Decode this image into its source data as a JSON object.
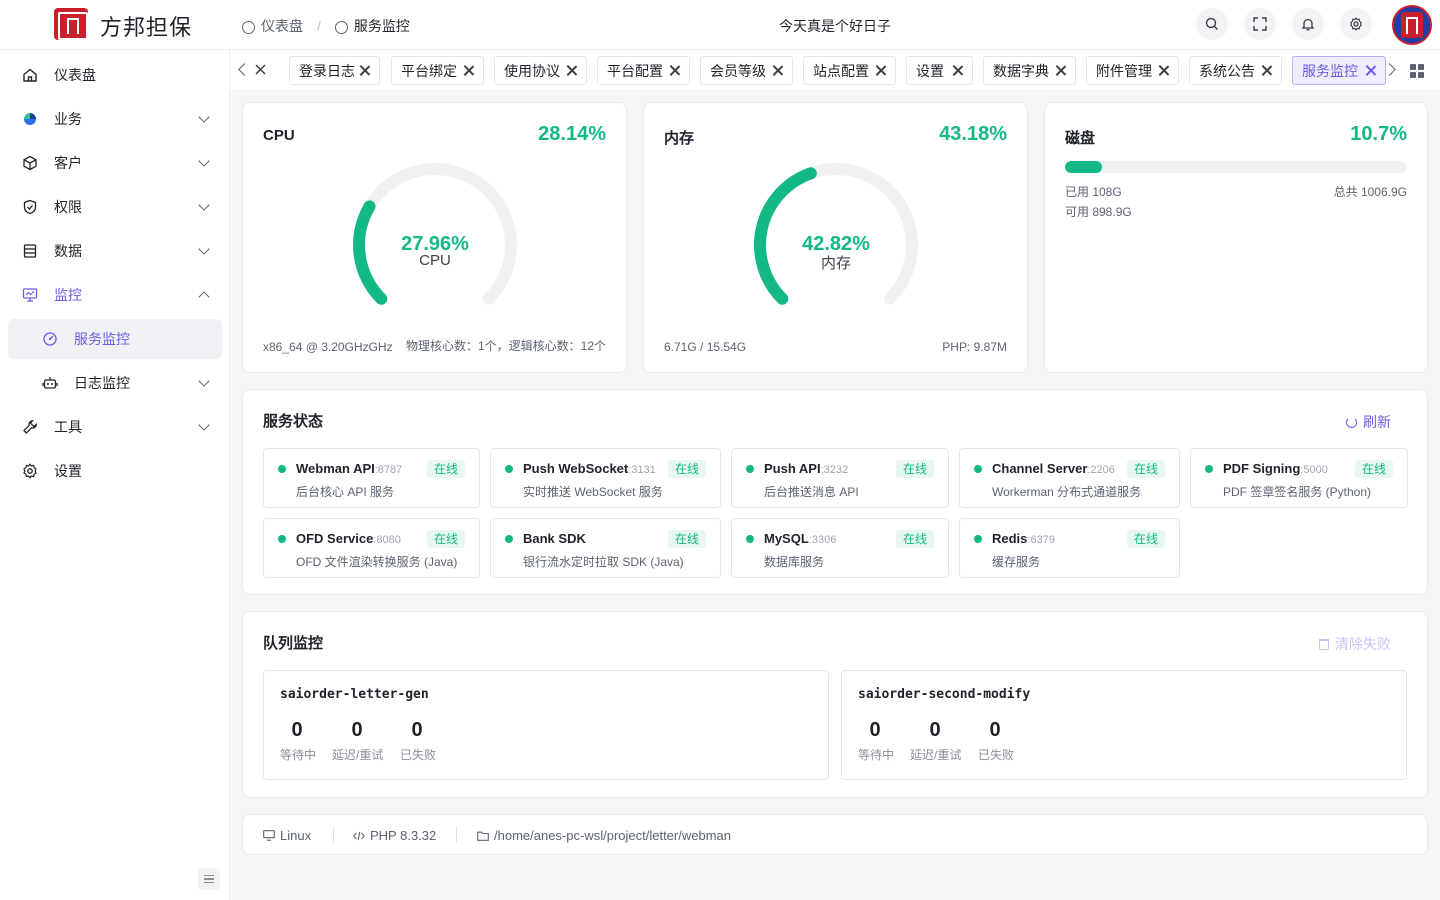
{
  "header": {
    "brand": "方邦担保",
    "breadcrumbs": [
      "仪表盘",
      "服务监控"
    ],
    "greeting": "今天真是个好日子"
  },
  "sidebar": {
    "items": [
      {
        "label": "仪表盘",
        "icon": "home-icon"
      },
      {
        "label": "业务",
        "icon": "business-icon"
      },
      {
        "label": "客户",
        "icon": "cube-icon"
      },
      {
        "label": "权限",
        "icon": "shield-icon"
      },
      {
        "label": "数据",
        "icon": "database-icon"
      },
      {
        "label": "监控",
        "icon": "monitor-icon"
      },
      {
        "label": "服务监控",
        "icon": "dashboard-icon"
      },
      {
        "label": "日志监控",
        "icon": "robot-icon"
      },
      {
        "label": "工具",
        "icon": "wrench-icon"
      },
      {
        "label": "设置",
        "icon": "gear-icon"
      }
    ]
  },
  "tabs": [
    "登录日志",
    "平台绑定",
    "使用协议",
    "平台配置",
    "会员等级",
    "站点配置",
    "设置",
    "数据字典",
    "附件管理",
    "系统公告",
    "服务监控"
  ],
  "colors": {
    "accent": "#6b5ce7",
    "success": "#12b886"
  },
  "metrics": {
    "cpu": {
      "title": "CPU",
      "percent": "28.14%",
      "gauge_value": "27.96%",
      "gauge_fraction": 0.2796,
      "gauge_label": "CPU",
      "footer_left": "x86_64 @ 3.20GHzGHz",
      "footer_right": "物理核心数：1个，逻辑核心数：12个"
    },
    "memory": {
      "title": "内存",
      "percent": "43.18%",
      "gauge_value": "42.82%",
      "gauge_fraction": 0.4282,
      "gauge_label": "内存",
      "footer_left": "6.71G / 15.54G",
      "footer_right": "PHP: 9.87M"
    },
    "disk": {
      "title": "磁盘",
      "percent": "10.7%",
      "fraction": 0.107,
      "used": "已用 108G",
      "total": "总共 1006.9G",
      "available": "可用 898.9G"
    }
  },
  "services": {
    "title": "服务状态",
    "refresh_label": "刷新",
    "items": [
      {
        "name": "Webman API",
        "port": ":8787",
        "desc": "后台核心 API 服务",
        "status": "在线"
      },
      {
        "name": "Push WebSocket",
        "port": ":3131",
        "desc": "实时推送 WebSocket 服务",
        "status": "在线"
      },
      {
        "name": "Push API",
        "port": ":3232",
        "desc": "后台推送消息 API",
        "status": "在线"
      },
      {
        "name": "Channel Server",
        "port": ":2206",
        "desc": "Workerman 分布式通道服务",
        "status": "在线"
      },
      {
        "name": "PDF Signing",
        "port": ":5000",
        "desc": "PDF 签章签名服务 (Python)",
        "status": "在线"
      },
      {
        "name": "OFD Service",
        "port": ":8080",
        "desc": "OFD 文件渲染转换服务 (Java)",
        "status": "在线"
      },
      {
        "name": "Bank SDK",
        "port": "",
        "desc": "银行流水定时拉取 SDK (Java)",
        "status": "在线"
      },
      {
        "name": "MySQL",
        "port": ":3306",
        "desc": "数据库服务",
        "status": "在线"
      },
      {
        "name": "Redis",
        "port": ":6379",
        "desc": "缓存服务",
        "status": "在线"
      }
    ]
  },
  "queues": {
    "title": "队列监控",
    "clear_label": "清除失败",
    "items": [
      {
        "name": "saiorder-letter-gen",
        "stats": [
          {
            "value": "0",
            "label": "等待中"
          },
          {
            "value": "0",
            "label": "延迟/重试"
          },
          {
            "value": "0",
            "label": "已失败"
          }
        ]
      },
      {
        "name": "saiorder-second-modify",
        "stats": [
          {
            "value": "0",
            "label": "等待中"
          },
          {
            "value": "0",
            "label": "延迟/重试"
          },
          {
            "value": "0",
            "label": "已失败"
          }
        ]
      }
    ]
  },
  "environment": {
    "os": "Linux",
    "php": "PHP 8.3.32",
    "path": "/home/anes-pc-wsl/project/letter/webman"
  }
}
